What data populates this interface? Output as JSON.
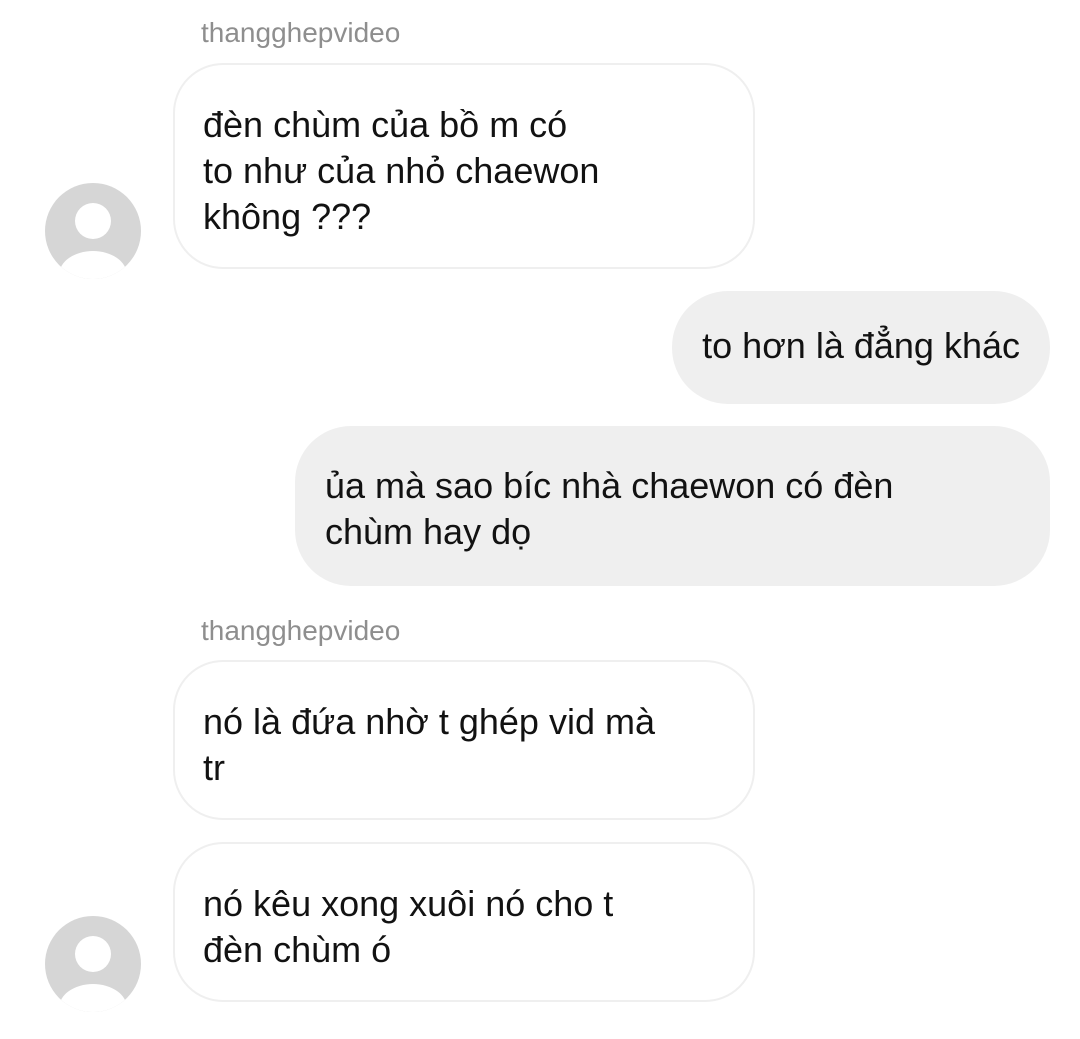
{
  "messages": [
    {
      "sender": "thangghepvideo",
      "lines": [
        "đèn chùm của bồ m có\nto như của nhỏ chaewon\nkhông ???"
      ]
    },
    {
      "sender": "me",
      "lines": [
        "to hơn là đẳng khác",
        "ủa mà sao bíc nhà chaewon có đèn\nchùm hay dọ"
      ]
    },
    {
      "sender": "thangghepvideo",
      "lines": [
        "nó là đứa nhờ t ghép vid mà\ntr",
        "nó kêu xong xuôi nó cho t\nđèn chùm ó"
      ]
    }
  ],
  "colors": {
    "incoming_bubble": "#ffffff",
    "incoming_border": "#efefef",
    "outgoing_bubble": "#efefef",
    "sender_name": "#8e8e8e",
    "avatar": "#d6d6d6"
  },
  "icons": {
    "avatar": "default-avatar-icon"
  }
}
